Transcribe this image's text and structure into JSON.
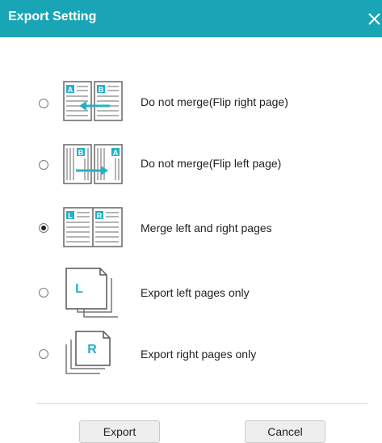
{
  "dialog": {
    "title": "Export Setting",
    "close_icon": "close-icon",
    "accent_color": "#1aa5b7"
  },
  "options": [
    {
      "label": "Do not merge(Flip right page)",
      "icon": "flip-right-page-icon",
      "left_letter": "A",
      "right_letter": "B",
      "selected": false
    },
    {
      "label": "Do not merge(Flip left page)",
      "icon": "flip-left-page-icon",
      "left_letter": "B",
      "right_letter": "A",
      "selected": false
    },
    {
      "label": "Merge left and right pages",
      "icon": "merge-pages-icon",
      "left_letter": "L",
      "right_letter": "R",
      "selected": true
    },
    {
      "label": "Export left pages only",
      "icon": "left-pages-stack-icon",
      "letter": "L",
      "selected": false
    },
    {
      "label": "Export right pages only",
      "icon": "right-pages-stack-icon",
      "letter": "R",
      "selected": false
    }
  ],
  "buttons": {
    "export_label": "Export",
    "cancel_label": "Cancel"
  }
}
